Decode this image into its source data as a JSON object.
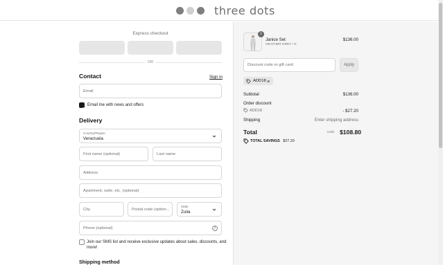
{
  "brand": {
    "name": "three dots",
    "dot_colors": [
      "#7f7f7f",
      "#cfcfcf",
      "#7f7f7f"
    ]
  },
  "express": {
    "label": "Express checkout",
    "or": "OR"
  },
  "contact": {
    "title": "Contact",
    "sign_in": "Sign in",
    "email_placeholder": "Email",
    "news_label": "Email me with news and offers",
    "news_checked": true
  },
  "delivery": {
    "title": "Delivery",
    "country_label": "Country/Region",
    "country_value": "Venezuela",
    "first_name": "First name (optional)",
    "last_name": "Last name",
    "address": "Address",
    "apartment": "Apartment, suite, etc. (optional)",
    "city": "City",
    "postal": "Postal code (option...",
    "state_label": "State",
    "state_value": "Zulia",
    "phone": "Phone (optional)",
    "sms_label_1": "Join our SMS list and receive exclusive updates about sales, discounts, and",
    "sms_label_2": "more!",
    "sms_checked": false
  },
  "shipping_method": {
    "title": "Shipping method"
  },
  "summary": {
    "item": {
      "quantity": "1",
      "name": "Janice Set",
      "variant": "HEATHER GREY / S",
      "price": "$136.00"
    },
    "discount_placeholder": "Discount code or gift card",
    "apply": "Apply",
    "chip_code": "ADD18",
    "subtotal_label": "Subtotal",
    "subtotal_value": "$136.00",
    "order_discount_label": "Order discount",
    "discount_code": "ADD18",
    "discount_value": "- $27.20",
    "shipping_label": "Shipping",
    "shipping_value": "Enter shipping address",
    "total_label": "Total",
    "currency": "USD",
    "total_value": "$108.80",
    "savings_label": "TOTAL SAVINGS",
    "savings_value": "$27.20"
  },
  "colors": {
    "accent_dark": "#1a1a1a",
    "summary_bg": "#f5f5f5",
    "muted_text": "#707070"
  }
}
